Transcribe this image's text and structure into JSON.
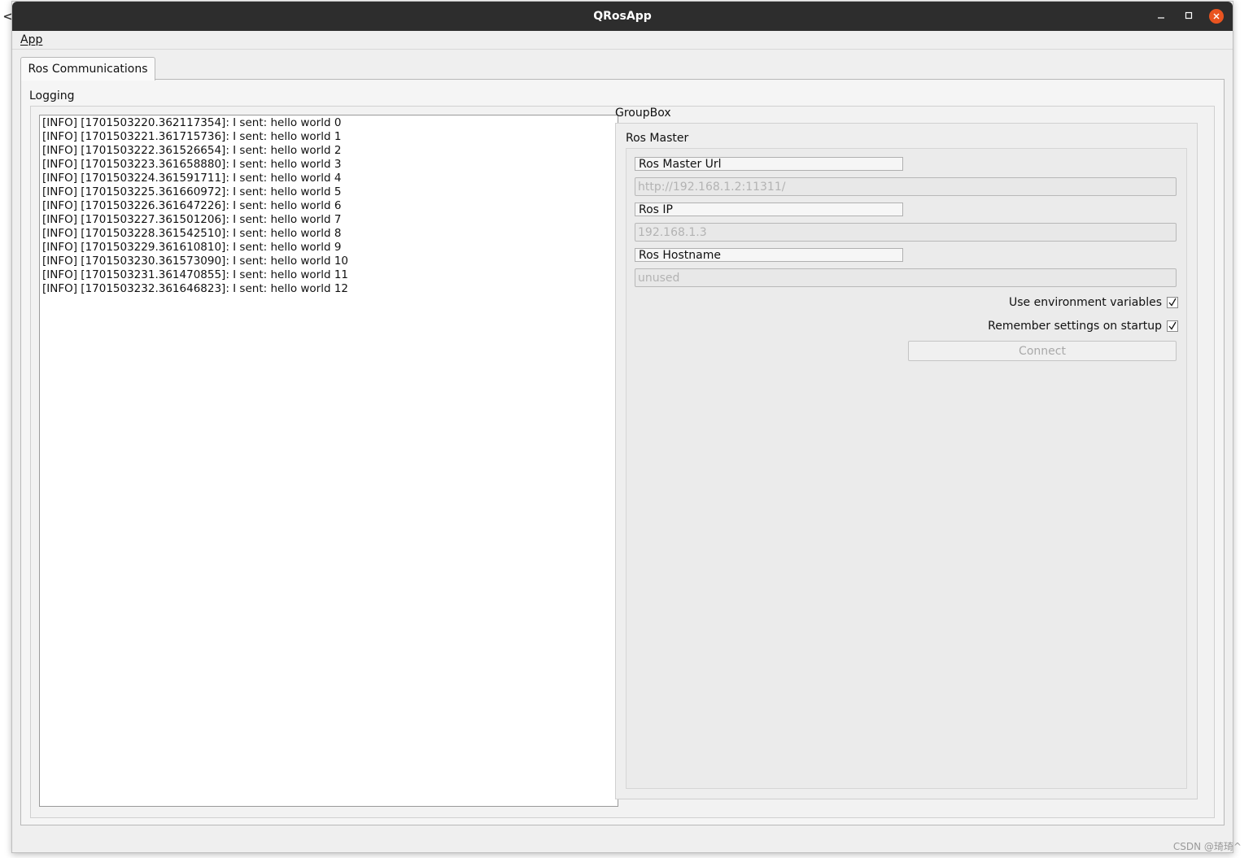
{
  "window": {
    "title": "QRosApp"
  },
  "menubar": {
    "app_label": "App"
  },
  "tabs": [
    {
      "label": "Ros Communications",
      "active": true
    }
  ],
  "logging": {
    "label": "Logging",
    "lines": [
      "[INFO] [1701503220.362117354]: I sent: hello world 0",
      "[INFO] [1701503221.361715736]: I sent: hello world 1",
      "[INFO] [1701503222.361526654]: I sent: hello world 2",
      "[INFO] [1701503223.361658880]: I sent: hello world 3",
      "[INFO] [1701503224.361591711]: I sent: hello world 4",
      "[INFO] [1701503225.361660972]: I sent: hello world 5",
      "[INFO] [1701503226.361647226]: I sent: hello world 6",
      "[INFO] [1701503227.361501206]: I sent: hello world 7",
      "[INFO] [1701503228.361542510]: I sent: hello world 8",
      "[INFO] [1701503229.361610810]: I sent: hello world 9",
      "[INFO] [1701503230.361573090]: I sent: hello world 10",
      "[INFO] [1701503231.361470855]: I sent: hello world 11",
      "[INFO] [1701503232.361646823]: I sent: hello world 12"
    ]
  },
  "groupbox": {
    "label": "GroupBox",
    "ros_master": {
      "label": "Ros Master",
      "master_url_label": "Ros Master Url",
      "master_url_value": "http://192.168.1.2:11311/",
      "ip_label": "Ros IP",
      "ip_value": "192.168.1.3",
      "hostname_label": "Ros Hostname",
      "hostname_value": "unused",
      "use_env_label": "Use environment variables",
      "use_env_checked": true,
      "remember_label": "Remember settings on startup",
      "remember_checked": true,
      "connect_label": "Connect"
    }
  },
  "watermark": "CSDN @琦琦^"
}
